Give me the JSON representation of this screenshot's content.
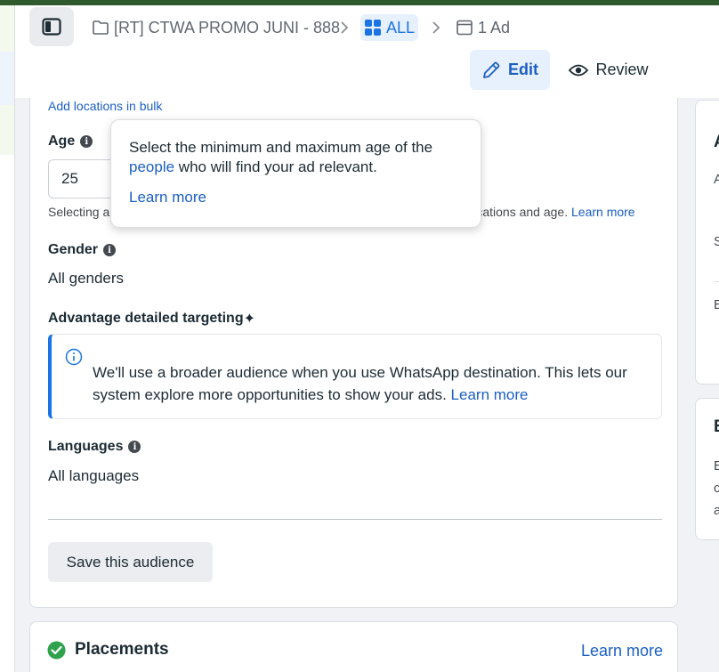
{
  "breadcrumb": {
    "campaign": "[RT] CTWA PROMO JUNI - 888",
    "adset": "ALL",
    "ad": "1 Ad"
  },
  "toolbar": {
    "edit_label": "Edit",
    "review_label": "Review"
  },
  "audience": {
    "bulk_link": "Add locations in bulk",
    "age_label": "Age",
    "age_min": "25",
    "age_note_start": "Selecting a",
    "age_note_end": "pp locations and age.",
    "age_note_link": "Learn more",
    "gender_label": "Gender",
    "gender_value": "All genders",
    "detailed_label": "Advantage detailed targeting",
    "detailed_sparkle": "✦",
    "notice_text": "We'll use a broader audience when you use WhatsApp destination. This lets our system explore more opportunities to show your ads.",
    "notice_link": "Learn more",
    "languages_label": "Languages",
    "languages_value": "All languages",
    "save_label": "Save this audience"
  },
  "tooltip": {
    "text_before": "Select the minimum and maximum age of the",
    "highlight": "people",
    "text_after": "who will find your ad relevant.",
    "learn_more": "Learn more"
  },
  "placements": {
    "title": "Placements",
    "learn_more": "Learn more"
  },
  "right_panel": {
    "card1_title": "A",
    "card1_line1": "A",
    "card1_line2": "S",
    "card1_line3": "E",
    "card2_title": "E",
    "card2_line1": "E",
    "card2_line2": "c",
    "card2_line3": "a"
  },
  "colors": {
    "accent": "#1b74e4",
    "link": "#1b5fc2",
    "success": "#31a24c"
  }
}
